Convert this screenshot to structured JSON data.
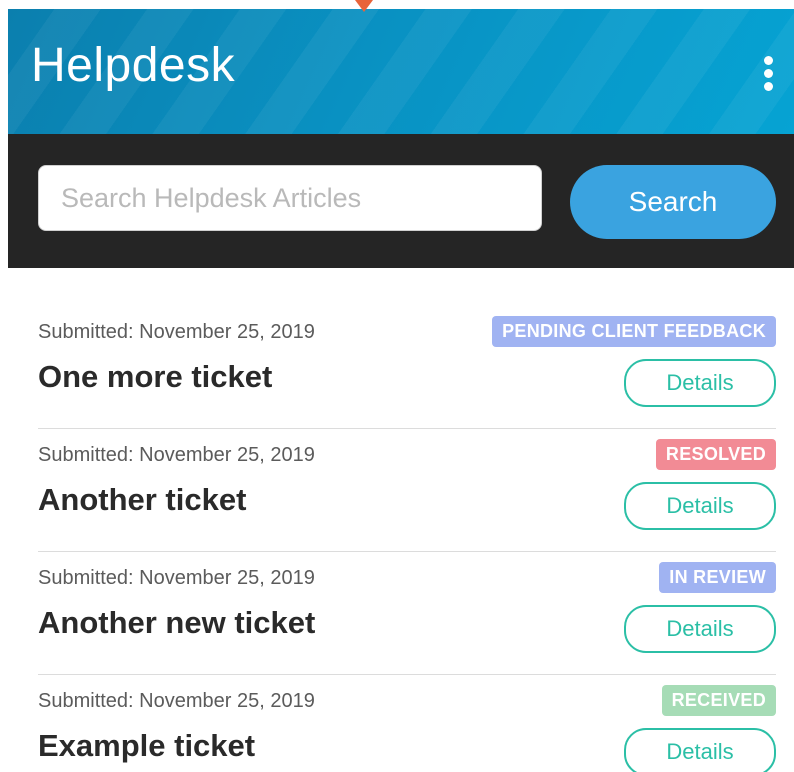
{
  "header": {
    "title": "Helpdesk",
    "menu_icon": "kebab-menu-icon"
  },
  "search": {
    "placeholder": "Search Helpdesk Articles",
    "value": "",
    "button_label": "Search"
  },
  "tickets": [
    {
      "submitted": "Submitted: November 25, 2019",
      "name": "One more ticket",
      "status": "PENDING CLIENT FEEDBACK",
      "status_color": "#a0b3f2",
      "details_label": "Details"
    },
    {
      "submitted": "Submitted: November 25, 2019",
      "name": "Another ticket",
      "status": "RESOLVED",
      "status_color": "#f28b95",
      "details_label": "Details"
    },
    {
      "submitted": "Submitted: November 25, 2019",
      "name": "Another new ticket",
      "status": "IN REVIEW",
      "status_color": "#a0b3f2",
      "details_label": "Details"
    },
    {
      "submitted": "Submitted: November 25, 2019",
      "name": "Example ticket",
      "status": "RECEIVED",
      "status_color": "#a6dcb6",
      "details_label": "Details"
    }
  ],
  "colors": {
    "header": "#0991c2",
    "search_bar": "#252525",
    "search_button": "#3aa3e0",
    "details_accent": "#2bbfa6"
  }
}
